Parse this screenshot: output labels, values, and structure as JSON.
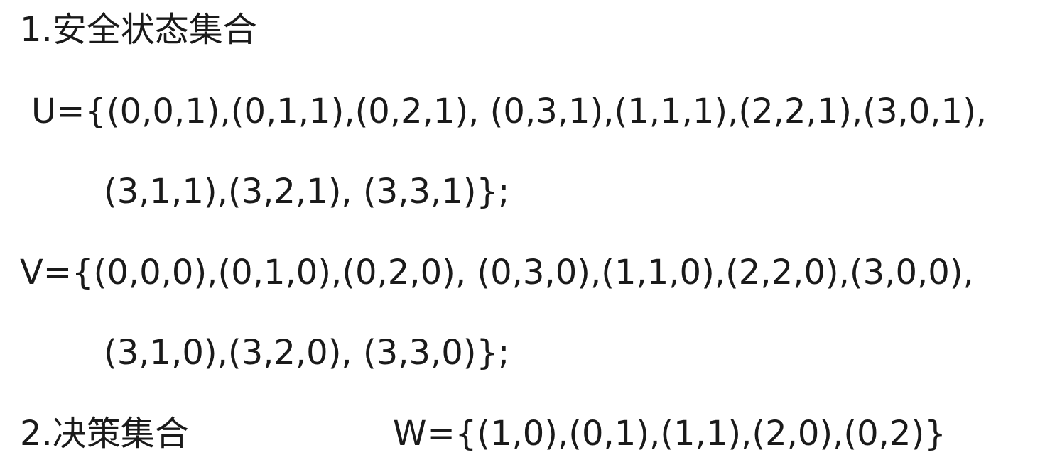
{
  "section1": {
    "heading": "1.安全状态集合",
    "U_line1": "U={(0,0,1),(0,1,1),(0,2,1), (0,3,1),(1,1,1),(2,2,1),(3,0,1),",
    "U_line2": "(3,1,1),(3,2,1), (3,3,1)};",
    "V_line1": "V={(0,0,0),(0,1,0),(0,2,0), (0,3,0),(1,1,0),(2,2,0),(3,0,0),",
    "V_line2": "(3,1,0),(3,2,0), (3,3,0)};"
  },
  "section2": {
    "heading": "2.决策集合",
    "W": "W={(1,0),(0,1),(1,1),(2,0),(0,2)}"
  }
}
